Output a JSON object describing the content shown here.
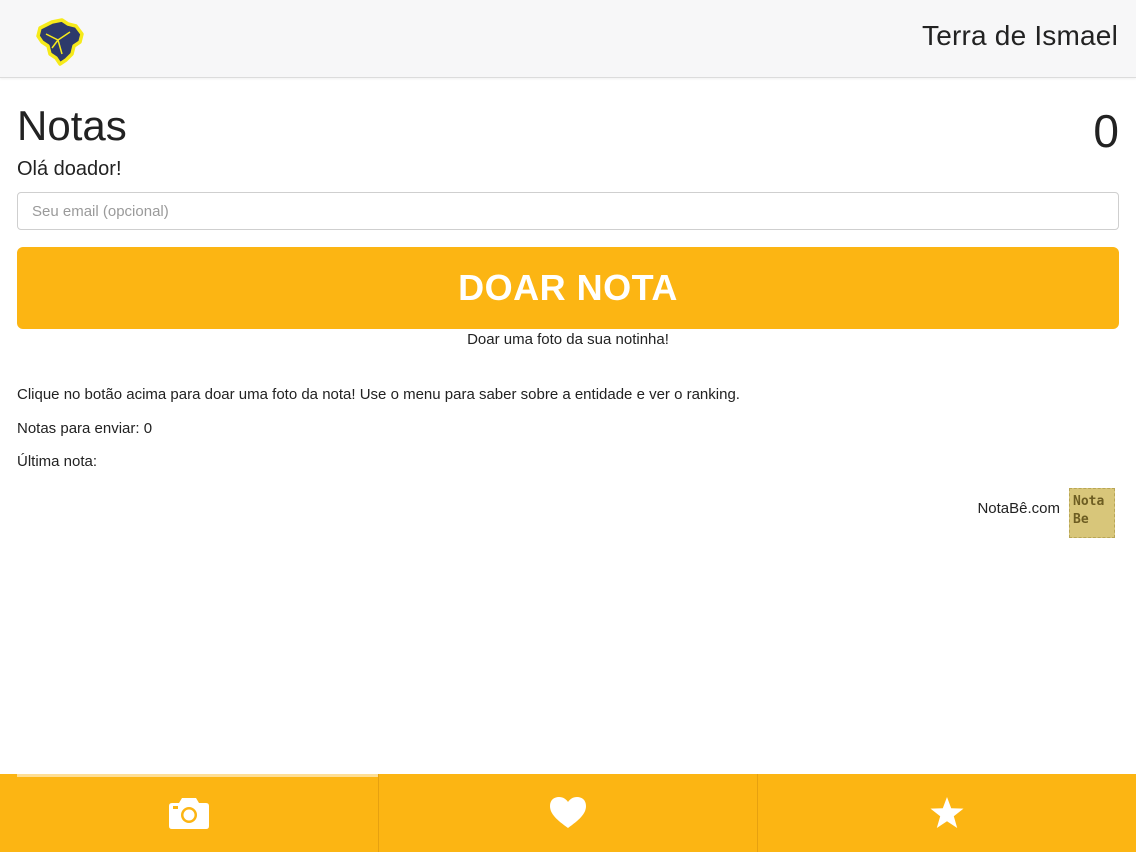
{
  "header": {
    "title": "Terra de Ismael",
    "logo_icon": "brazil-map-logo"
  },
  "main": {
    "title": "Notas",
    "count": "0",
    "greeting": "Olá doador!",
    "email_placeholder": "Seu email (opcional)",
    "email_value": "",
    "donate_button_label": "DOAR NOTA",
    "donate_subtitle": "Doar uma foto da sua notinha!",
    "instructions": "Clique no botão acima para doar uma foto da nota! Use o menu para saber sobre a entidade e ver o ranking.",
    "pending_notes": "Notas para enviar: 0",
    "last_note": "Última nota:",
    "footer_link": "NotaBê.com",
    "footer_logo_line1": "Nota",
    "footer_logo_line2": "Be"
  },
  "tabbar": {
    "tabs": [
      {
        "icon": "camera-icon",
        "active": true
      },
      {
        "icon": "heart-icon",
        "active": false
      },
      {
        "icon": "star-icon",
        "active": false
      }
    ]
  },
  "colors": {
    "accent": "#fcb513",
    "header_bg": "#f7f7f8",
    "text": "#222222"
  }
}
